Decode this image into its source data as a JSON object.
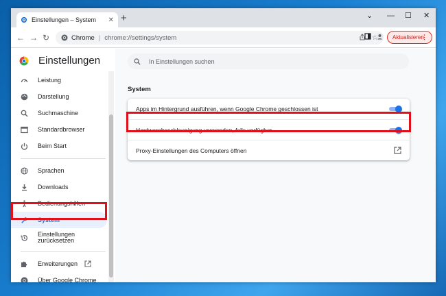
{
  "colors": {
    "accent": "#1a73e8",
    "highlight": "#e0101a",
    "update": "#d93025"
  },
  "tab": {
    "title": "Einstellungen – System",
    "close": "✕",
    "new_tab": "+"
  },
  "window_controls": {
    "minimize": "—",
    "maximize": "☐",
    "close": "✕",
    "dropdown": "⌄"
  },
  "nav": {
    "back": "←",
    "forward": "→",
    "reload": "↻"
  },
  "omnibox": {
    "site": "Chrome",
    "separator": "|",
    "url": "chrome://settings/system"
  },
  "toolbar": {
    "share_icon": "share-icon",
    "star_icon": "bookmark-star-icon",
    "update_label": "Aktualisieren",
    "menu_dots": "⋮"
  },
  "sidebar": {
    "title": "Einstellungen",
    "items": [
      {
        "label": "Leistung",
        "icon": "speedometer-icon"
      },
      {
        "label": "Darstellung",
        "icon": "palette-icon"
      },
      {
        "label": "Suchmaschine",
        "icon": "search-icon"
      },
      {
        "label": "Standardbrowser",
        "icon": "browser-icon"
      },
      {
        "label": "Beim Start",
        "icon": "power-icon"
      },
      {
        "label": "Sprachen",
        "icon": "globe-icon"
      },
      {
        "label": "Downloads",
        "icon": "download-icon"
      },
      {
        "label": "Bedienungshilfen",
        "icon": "accessibility-icon"
      },
      {
        "label": "System",
        "icon": "wrench-icon",
        "active": true
      },
      {
        "label": "Einstellungen zurücksetzen",
        "icon": "reset-icon"
      },
      {
        "label": "Erweiterungen",
        "icon": "puzzle-icon"
      },
      {
        "label": "Über Google Chrome",
        "icon": "chrome-logo-icon"
      }
    ]
  },
  "search": {
    "placeholder": "In Einstellungen suchen"
  },
  "main": {
    "section_title": "System",
    "rows": [
      {
        "label": "Apps im Hintergrund ausführen, wenn Google Chrome geschlossen ist",
        "enabled": true
      },
      {
        "label": "Hardwarebeschleunigung verwenden, falls verfügbar",
        "enabled": true
      },
      {
        "label": "Proxy-Einstellungen des Computers öffnen"
      }
    ]
  }
}
